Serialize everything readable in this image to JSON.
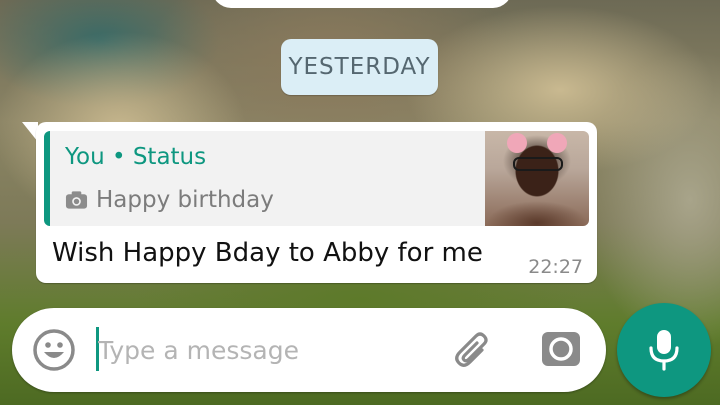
{
  "date_chip": {
    "label": "YESTERDAY"
  },
  "message": {
    "quoted": {
      "author": "You • Status",
      "text": "Happy birthday",
      "icon": "camera-icon",
      "thumbnail": "status-photo-thumbnail"
    },
    "text": "Wish Happy Bday to Abby for me",
    "time": "22:27"
  },
  "composer": {
    "placeholder": "Type a message",
    "value": "",
    "icons": {
      "emoji": "emoji-icon",
      "attach": "paperclip-icon",
      "camera": "camera-icon",
      "send": "microphone-icon"
    }
  },
  "colors": {
    "accent": "#0e9780",
    "bubble": "#ffffff",
    "date_chip_bg": "#dbeef6",
    "quote_bg": "#f2f2f2",
    "timestamp": "#8a8a8a"
  }
}
